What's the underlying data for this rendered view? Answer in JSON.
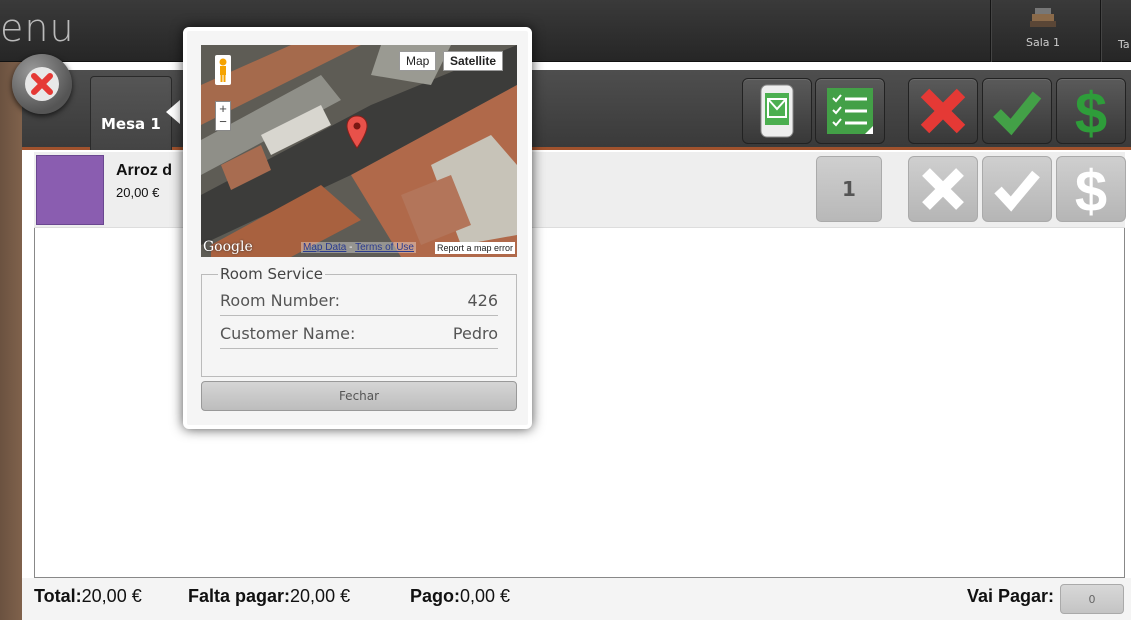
{
  "header": {
    "menu_title": "enu",
    "sala1_label": "Sala 1",
    "sala2_label": "Ta"
  },
  "toolbar": {
    "table_tab": "Mesa 1"
  },
  "order": {
    "item_name": "Arroz d",
    "item_price": "20,00 €",
    "quantity": "1"
  },
  "footer": {
    "total_label": "Total:",
    "total_value": "20,00 €",
    "falta_label": "Falta pagar:",
    "falta_value": "20,00 €",
    "pago_label": "Pago:",
    "pago_value": "0,00 €",
    "vai_label": "Vai Pagar:",
    "vai_value": "0"
  },
  "popup": {
    "map_btn": "Map",
    "satellite_btn": "Satellite",
    "google_logo": "Google",
    "map_data": "Map Data",
    "terms": "Terms of Use",
    "report": "Report a map error",
    "section_title": "Room Service",
    "room_label": "Room Number:",
    "room_value": "426",
    "customer_label": "Customer Name:",
    "customer_value": "Pedro",
    "close_label": "Fechar"
  },
  "colors": {
    "accent_orange": "#a0522d",
    "item_thumb": "#8a5db0",
    "cancel_red": "#e53935",
    "confirm_green": "#43a047",
    "pay_green": "#2e7d32"
  }
}
